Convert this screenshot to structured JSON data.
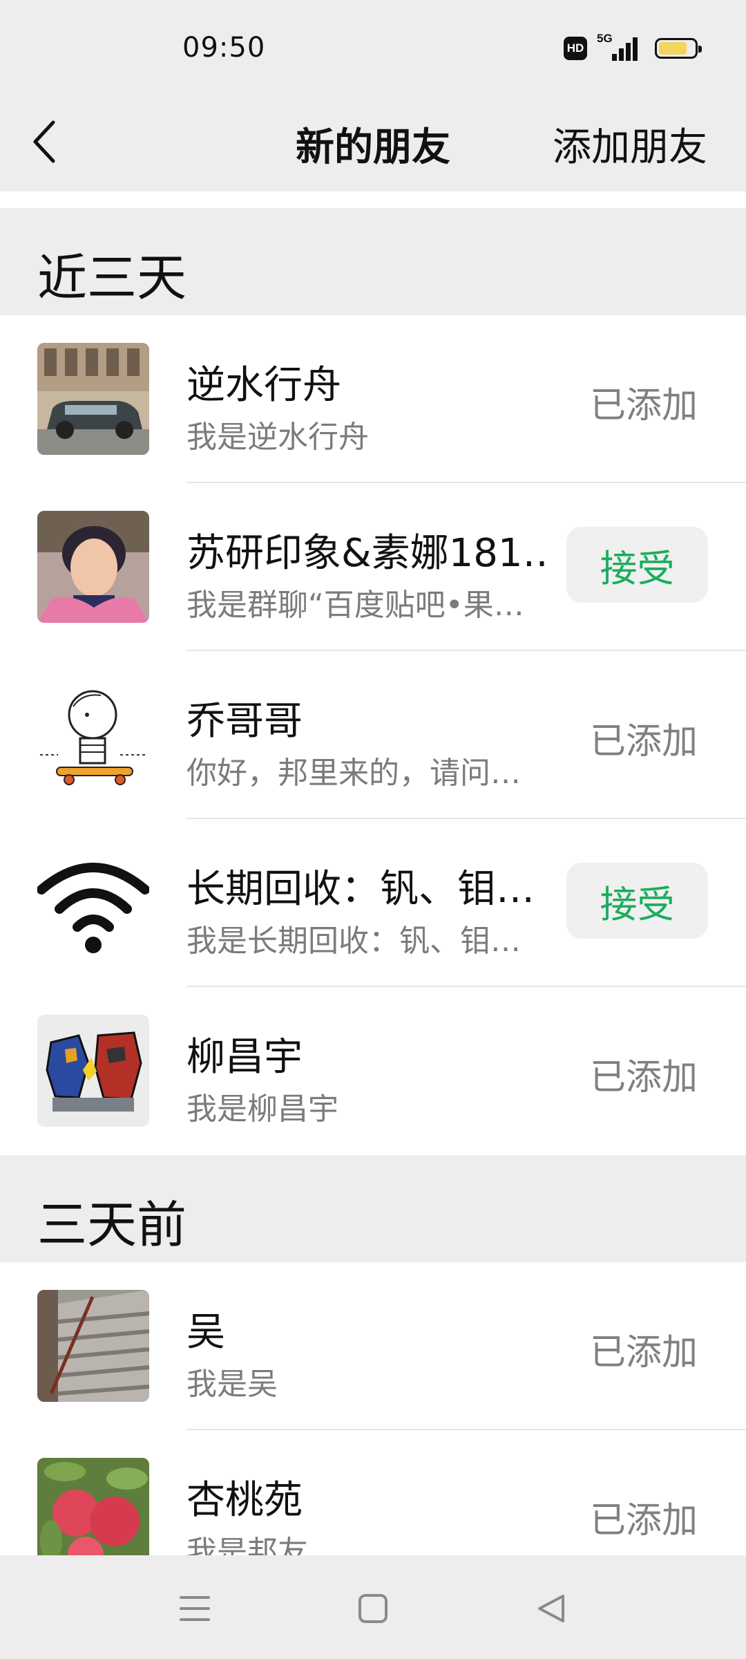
{
  "status_bar": {
    "time": "09:50",
    "network": "5G",
    "hd": "HD"
  },
  "nav": {
    "title": "新的朋友",
    "add_friend": "添加朋友"
  },
  "sections": [
    {
      "title": "近三天",
      "contacts": [
        {
          "name": "逆水行舟",
          "message": "我是逆水行舟",
          "status": "已添加",
          "action": null
        },
        {
          "name": "苏研印象&素娜181…",
          "message": "我是群聊“百度贴吧•果…",
          "status": null,
          "action": "接受"
        },
        {
          "name": "乔哥哥",
          "message": "你好，邦里来的，请问…",
          "status": "已添加",
          "action": null
        },
        {
          "name": "长期回收：钒、钼…",
          "message": "我是长期回收：钒、钼…",
          "status": null,
          "action": "接受"
        },
        {
          "name": "柳昌宇",
          "message": "我是柳昌宇",
          "status": "已添加",
          "action": null
        }
      ]
    },
    {
      "title": "三天前",
      "contacts": [
        {
          "name": "吴",
          "message": "我是吴",
          "status": "已添加",
          "action": null
        },
        {
          "name": "杏桃苑",
          "message": "我是邦友",
          "status": "已添加",
          "action": null
        }
      ]
    }
  ],
  "colors": {
    "accent_green": "#1aad5d",
    "background": "#ededed"
  }
}
